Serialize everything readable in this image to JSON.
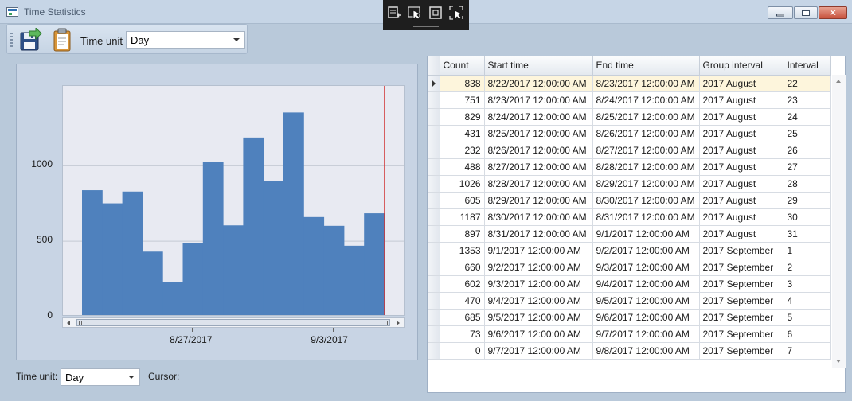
{
  "window": {
    "title": "Time Statistics"
  },
  "toolbar": {
    "time_unit_label": "Time unit",
    "time_unit_value": "Day"
  },
  "bottom": {
    "time_unit_label": "Time unit:",
    "time_unit_value": "Day",
    "cursor_label": "Cursor:"
  },
  "grid": {
    "columns": [
      "Count",
      "Start time",
      "End time",
      "Group interval",
      "Interval"
    ],
    "rows": [
      [
        "838",
        "8/22/2017 12:00:00 AM",
        "8/23/2017 12:00:00 AM",
        "2017 August",
        "22"
      ],
      [
        "751",
        "8/23/2017 12:00:00 AM",
        "8/24/2017 12:00:00 AM",
        "2017 August",
        "23"
      ],
      [
        "829",
        "8/24/2017 12:00:00 AM",
        "8/25/2017 12:00:00 AM",
        "2017 August",
        "24"
      ],
      [
        "431",
        "8/25/2017 12:00:00 AM",
        "8/26/2017 12:00:00 AM",
        "2017 August",
        "25"
      ],
      [
        "232",
        "8/26/2017 12:00:00 AM",
        "8/27/2017 12:00:00 AM",
        "2017 August",
        "26"
      ],
      [
        "488",
        "8/27/2017 12:00:00 AM",
        "8/28/2017 12:00:00 AM",
        "2017 August",
        "27"
      ],
      [
        "1026",
        "8/28/2017 12:00:00 AM",
        "8/29/2017 12:00:00 AM",
        "2017 August",
        "28"
      ],
      [
        "605",
        "8/29/2017 12:00:00 AM",
        "8/30/2017 12:00:00 AM",
        "2017 August",
        "29"
      ],
      [
        "1187",
        "8/30/2017 12:00:00 AM",
        "8/31/2017 12:00:00 AM",
        "2017 August",
        "30"
      ],
      [
        "897",
        "8/31/2017 12:00:00 AM",
        "9/1/2017 12:00:00 AM",
        "2017 August",
        "31"
      ],
      [
        "1353",
        "9/1/2017 12:00:00 AM",
        "9/2/2017 12:00:00 AM",
        "2017 September",
        "1"
      ],
      [
        "660",
        "9/2/2017 12:00:00 AM",
        "9/3/2017 12:00:00 AM",
        "2017 September",
        "2"
      ],
      [
        "602",
        "9/3/2017 12:00:00 AM",
        "9/4/2017 12:00:00 AM",
        "2017 September",
        "3"
      ],
      [
        "470",
        "9/4/2017 12:00:00 AM",
        "9/5/2017 12:00:00 AM",
        "2017 September",
        "4"
      ],
      [
        "685",
        "9/5/2017 12:00:00 AM",
        "9/6/2017 12:00:00 AM",
        "2017 September",
        "5"
      ],
      [
        "73",
        "9/6/2017 12:00:00 AM",
        "9/7/2017 12:00:00 AM",
        "2017 September",
        "6"
      ],
      [
        "0",
        "9/7/2017 12:00:00 AM",
        "9/8/2017 12:00:00 AM",
        "2017 September",
        "7"
      ]
    ],
    "selected_row": 0
  },
  "chart_data": {
    "type": "bar",
    "categories": [
      "8/22/2017",
      "8/23/2017",
      "8/24/2017",
      "8/25/2017",
      "8/26/2017",
      "8/27/2017",
      "8/28/2017",
      "8/29/2017",
      "8/30/2017",
      "8/31/2017",
      "9/1/2017",
      "9/2/2017",
      "9/3/2017",
      "9/4/2017",
      "9/5/2017"
    ],
    "values": [
      838,
      751,
      829,
      431,
      232,
      488,
      1026,
      605,
      1187,
      897,
      1353,
      660,
      602,
      470,
      685
    ],
    "y_ticks": [
      "0",
      "500",
      "1000"
    ],
    "x_ticks": [
      "8/27/2017",
      "9/3/2017"
    ],
    "ylim": [
      0,
      1500
    ],
    "grid": true,
    "bar_color": "#4f81bd",
    "cursor_color": "#d03030"
  },
  "icons": {
    "save": "save-disk-icon",
    "clipboard": "clipboard-icon"
  }
}
